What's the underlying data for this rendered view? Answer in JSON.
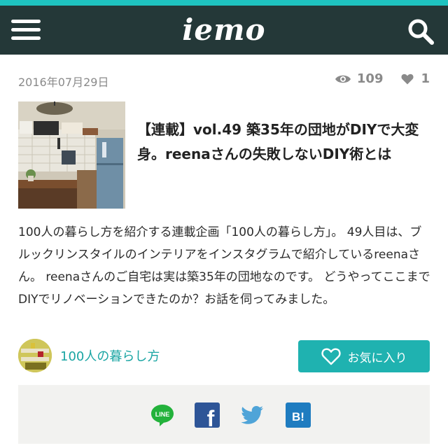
{
  "header": {
    "logo_text": "iemo",
    "accent_color": "#1ec3c0",
    "background_color": "#243838"
  },
  "article": {
    "date": "2016年07月29日",
    "views": "109",
    "likes": "1",
    "title": "【連載】vol.49 築35年の団地がDIYで大変身。reenaさんの失敗しないDIY術とは",
    "description": "100人の暮らし方を紹介する連載企画「100人の暮らし方」。 49人目は、ブルックリンスタイルのインテリアをインスタグラムで紹介しているreenaさん。 reenaさんのご自宅は実は築35年の団地なのです。 どうやってここまでDIYでリノベーションできたのか？お話を伺ってみました。"
  },
  "author": {
    "name": "100人の暮らし方"
  },
  "favorite_button": {
    "label": "お気に入り",
    "color": "#1fb2b0"
  },
  "share": {
    "line_label": "LINE",
    "facebook_label": "f",
    "hatena_label": "B!"
  },
  "icons": [
    "menu-icon",
    "search-icon",
    "eye-icon",
    "heart-icon",
    "line-icon",
    "facebook-icon",
    "twitter-icon",
    "hatena-bookmark-icon"
  ]
}
